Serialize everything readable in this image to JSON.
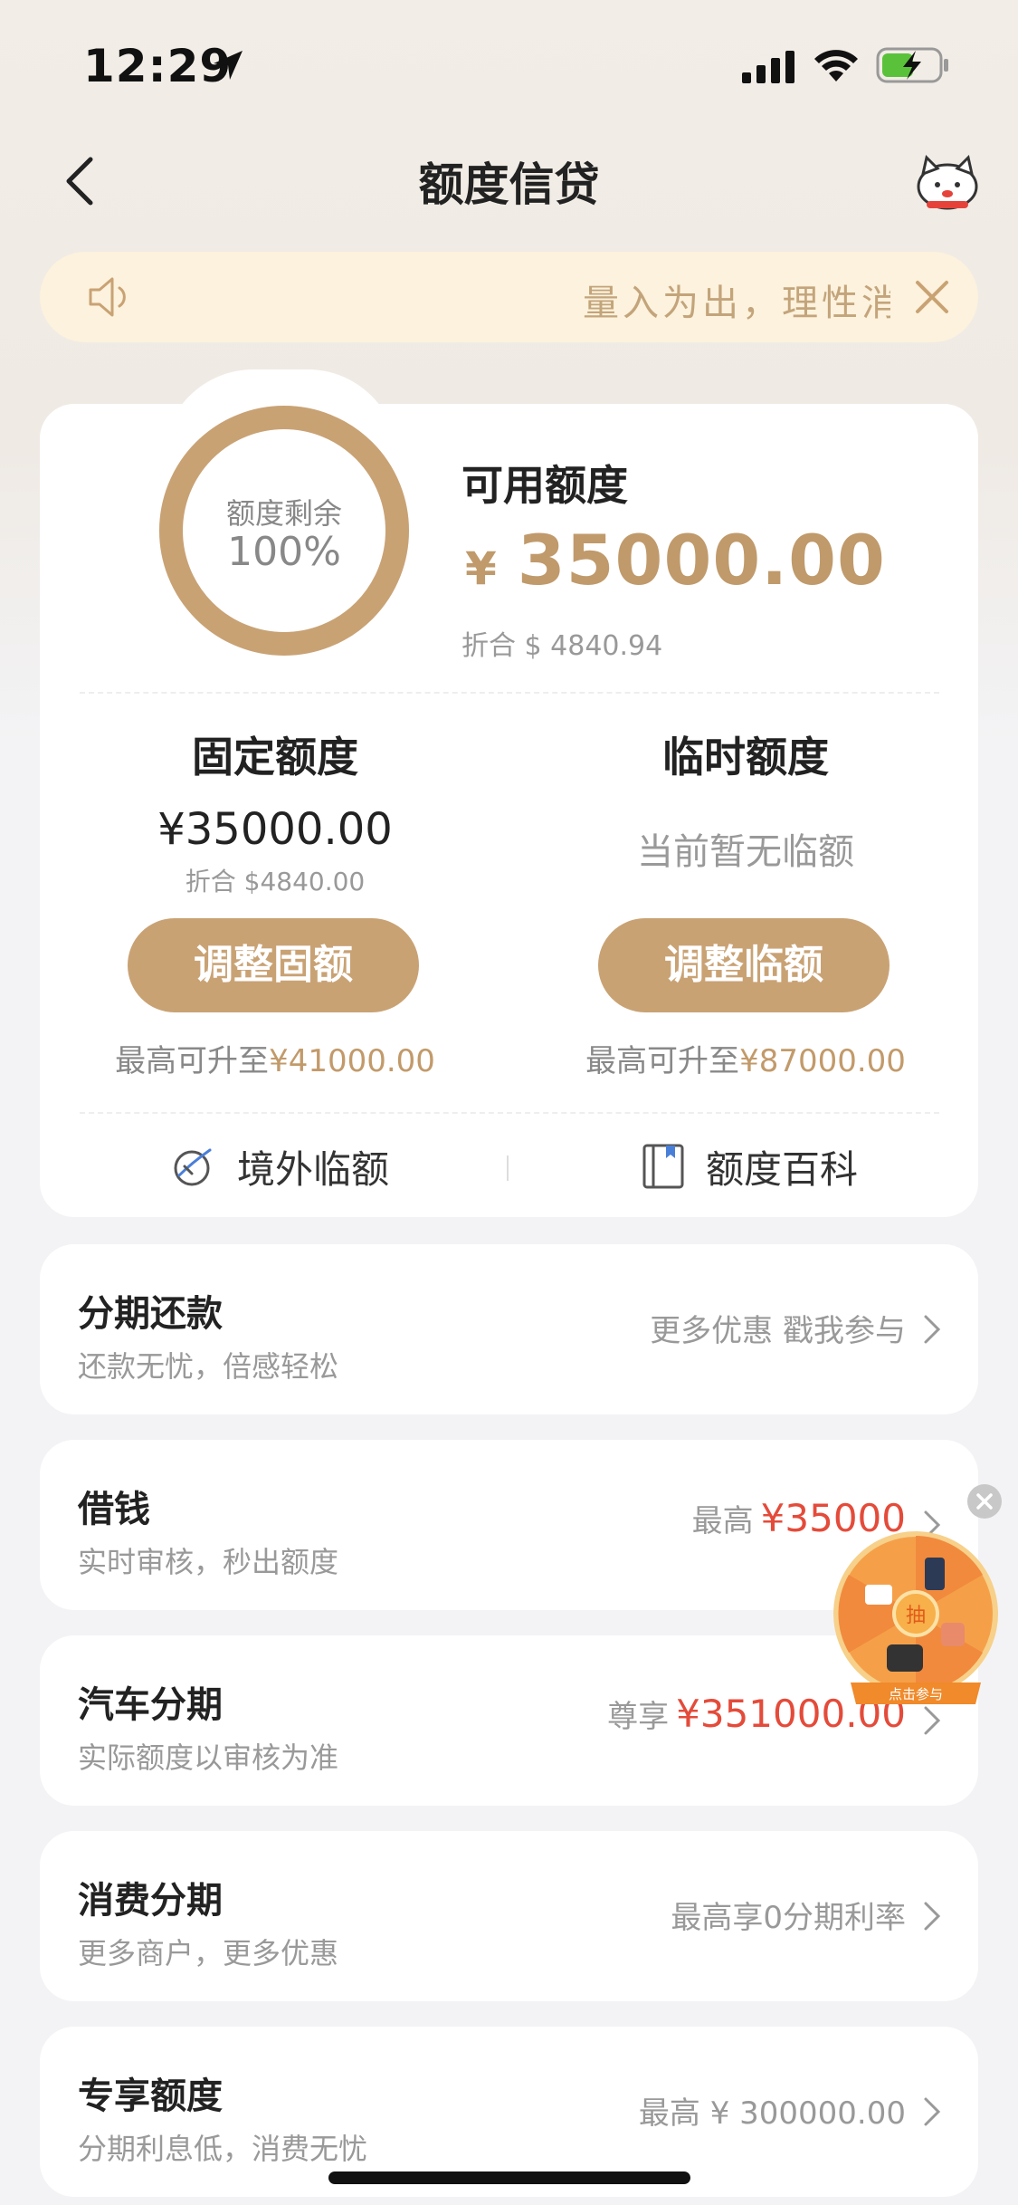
{
  "status_bar": {
    "time": "12:29"
  },
  "nav": {
    "title": "额度信贷"
  },
  "notice": {
    "text": "量入为出，理性消费"
  },
  "credit_card": {
    "ring_label": "额度剩余",
    "ring_percent": "100%",
    "ring_fraction": 1.0,
    "available_label": "可用额度",
    "available_currency": "¥",
    "available_amount": "35000.00",
    "available_converted": "折合 $ 4840.94",
    "fixed": {
      "title": "固定额度",
      "amount": "¥35000.00",
      "converted": "折合 $4840.00",
      "button": "调整固额",
      "max_prefix": "最高可升至",
      "max_value": "¥41000.00"
    },
    "temporary": {
      "title": "临时额度",
      "none_text": "当前暂无临额",
      "button": "调整临额",
      "max_prefix": "最高可升至",
      "max_value": "¥87000.00"
    },
    "links": {
      "overseas": "境外临额",
      "wiki": "额度百科"
    }
  },
  "rows": [
    {
      "title": "分期还款",
      "desc": "还款无忧，倍感轻松",
      "right_text": "更多优惠 戳我参与",
      "right_value": ""
    },
    {
      "title": "借钱",
      "desc": "实时审核，秒出额度",
      "right_text": "最高",
      "right_value": "¥35000"
    },
    {
      "title": "汽车分期",
      "desc": "实际额度以审核为准",
      "right_text": "尊享",
      "right_value": "¥351000.00"
    },
    {
      "title": "消费分期",
      "desc": "更多商户，更多优惠",
      "right_text": "最高享0分期利率",
      "right_value": ""
    },
    {
      "title": "专享额度",
      "desc": "分期利息低，消费无忧",
      "right_text": "最高 ¥ 300000.00",
      "right_value": ""
    }
  ],
  "promo_wheel": {
    "center_label": "抽",
    "caption": "点击参与"
  },
  "colors": {
    "accent": "#c9a274",
    "amount_gold": "#c09a6b",
    "red": "#e44b3a",
    "notice_bg": "#fcf2dd"
  }
}
